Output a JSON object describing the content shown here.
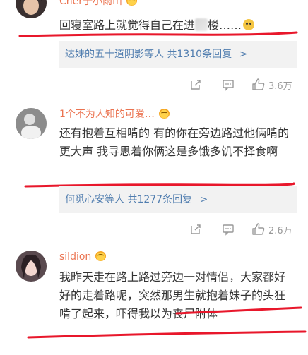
{
  "comments": [
    {
      "username": "Cher子小雨山",
      "text_before": "回寝室路上就觉得自己在进",
      "text_after": "楼……",
      "replies": {
        "label": "达妹的五十道阴影等人",
        "count": "共1310条回复",
        "chevron": ">"
      },
      "likes": "3.6万"
    },
    {
      "username": "1个不为人知的可爱…",
      "text": "还有抱着互相啃的 有的你在旁边路过他俩啃的更大声 我寻思着你俩这是多饿多饥不择食啊",
      "replies": {
        "label": "何觅心安等人",
        "count": "共1277条回复",
        "chevron": ">"
      },
      "likes": "2.6万"
    },
    {
      "username": "sildion",
      "text": "我昨天走在路上路过旁边一对情侣，大家都好好的走着路呢，突然那男生就抱着妹子的头狂啃了起来，吓得我以为丧尸附体"
    }
  ],
  "colors": {
    "username": "#eb7350",
    "link": "#507daf",
    "annotation": "#e8172b"
  }
}
